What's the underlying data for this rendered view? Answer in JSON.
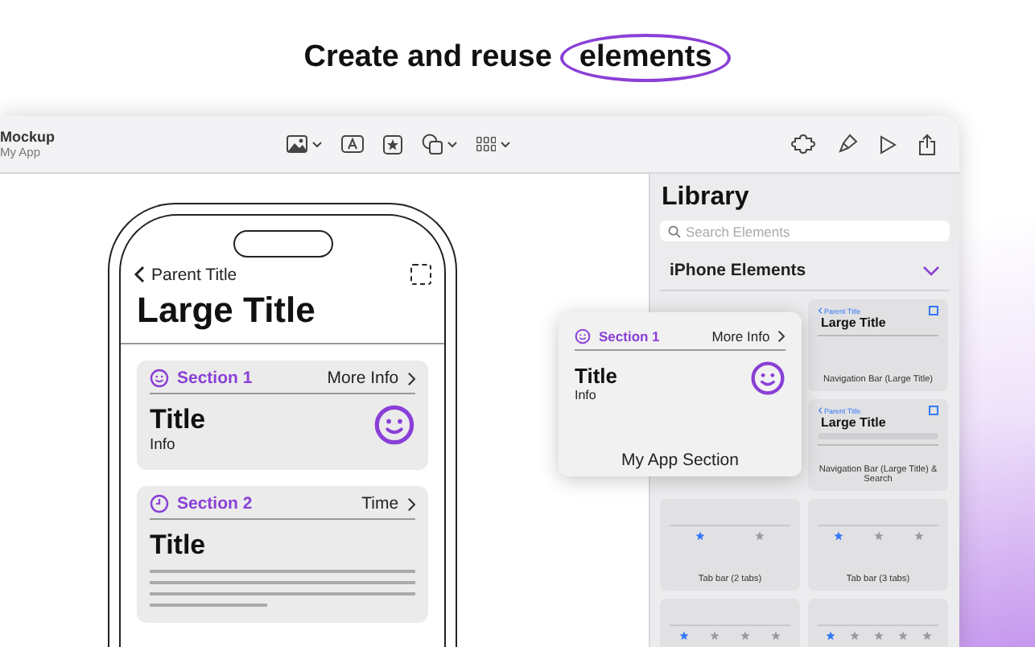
{
  "headline": {
    "text": "Create and reuse",
    "highlight": "elements"
  },
  "window": {
    "title": "Mockup",
    "subtitle": "My App"
  },
  "phone": {
    "back_label": "Parent Title",
    "large_title": "Large Title",
    "sections": [
      {
        "kind": "info",
        "header": "Section 1",
        "accessory": "More Info",
        "title": "Title",
        "subtitle": "Info"
      },
      {
        "kind": "text",
        "header": "Section 2",
        "accessory": "Time",
        "title": "Title"
      }
    ]
  },
  "library": {
    "title": "Library",
    "search_placeholder": "Search Elements",
    "group": {
      "name": "iPhone Elements",
      "expanded": true
    },
    "tiles": [
      {
        "kind": "nav",
        "back_label": "Parent Title",
        "title": "Large Title",
        "caption": "Navigation Bar (Large Title)"
      },
      {
        "kind": "nav_search",
        "back_label": "Parent Title",
        "title": "Large Title",
        "caption": "Navigation Bar (Large Title) & Search"
      },
      {
        "kind": "tabbar",
        "tabs": [
          {
            "selected": true
          },
          {
            "selected": false
          }
        ],
        "caption": "Tab bar (2 tabs)"
      },
      {
        "kind": "tabbar",
        "tabs": [
          {
            "selected": true
          },
          {
            "selected": false
          },
          {
            "selected": false
          }
        ],
        "caption": "Tab bar (3 tabs)"
      },
      {
        "kind": "tabbar",
        "tabs": [
          {
            "selected": true
          },
          {
            "selected": false
          },
          {
            "selected": false
          },
          {
            "selected": false
          }
        ]
      },
      {
        "kind": "tabbar",
        "tabs": [
          {
            "selected": true
          },
          {
            "selected": false
          },
          {
            "selected": false
          },
          {
            "selected": false
          },
          {
            "selected": false
          }
        ]
      }
    ],
    "dragged": {
      "kind": "info",
      "header": "Section 1",
      "accessory": "More Info",
      "title": "Title",
      "subtitle": "Info",
      "caption": "My App Section"
    }
  }
}
